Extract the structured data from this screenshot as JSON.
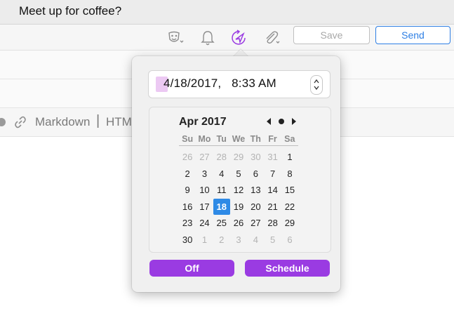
{
  "subject": "Meet up for coffee?",
  "toolbar": {
    "icons": [
      "mask-icon",
      "bell-icon",
      "send-later-icon",
      "paperclip-icon"
    ],
    "save_label": "Save",
    "send_label": "Send"
  },
  "format_bar": {
    "markdown_label": "Markdown",
    "separator": "|",
    "html_label": "HTM"
  },
  "scheduler": {
    "datetime": "4/18/2017,   8:33 AM",
    "month_label": "Apr 2017",
    "weekdays": [
      "Su",
      "Mo",
      "Tu",
      "We",
      "Th",
      "Fr",
      "Sa"
    ],
    "days": [
      {
        "d": "26",
        "m": true
      },
      {
        "d": "27",
        "m": true
      },
      {
        "d": "28",
        "m": true
      },
      {
        "d": "29",
        "m": true
      },
      {
        "d": "30",
        "m": true
      },
      {
        "d": "31",
        "m": true
      },
      {
        "d": "1"
      },
      {
        "d": "2"
      },
      {
        "d": "3"
      },
      {
        "d": "4"
      },
      {
        "d": "5"
      },
      {
        "d": "6"
      },
      {
        "d": "7"
      },
      {
        "d": "8"
      },
      {
        "d": "9"
      },
      {
        "d": "10"
      },
      {
        "d": "11"
      },
      {
        "d": "12"
      },
      {
        "d": "13"
      },
      {
        "d": "14"
      },
      {
        "d": "15"
      },
      {
        "d": "16"
      },
      {
        "d": "17"
      },
      {
        "d": "18",
        "sel": true
      },
      {
        "d": "19"
      },
      {
        "d": "20"
      },
      {
        "d": "21"
      },
      {
        "d": "22"
      },
      {
        "d": "23"
      },
      {
        "d": "24"
      },
      {
        "d": "25"
      },
      {
        "d": "26"
      },
      {
        "d": "27"
      },
      {
        "d": "28"
      },
      {
        "d": "29"
      },
      {
        "d": "30"
      },
      {
        "d": "1",
        "m": true
      },
      {
        "d": "2",
        "m": true
      },
      {
        "d": "3",
        "m": true
      },
      {
        "d": "4",
        "m": true
      },
      {
        "d": "5",
        "m": true
      },
      {
        "d": "6",
        "m": true
      }
    ],
    "off_label": "Off",
    "schedule_label": "Schedule"
  },
  "colors": {
    "accent_purple": "#9a3be2",
    "selected_blue": "#2e8ae6",
    "send_blue": "#2e7fe4"
  }
}
